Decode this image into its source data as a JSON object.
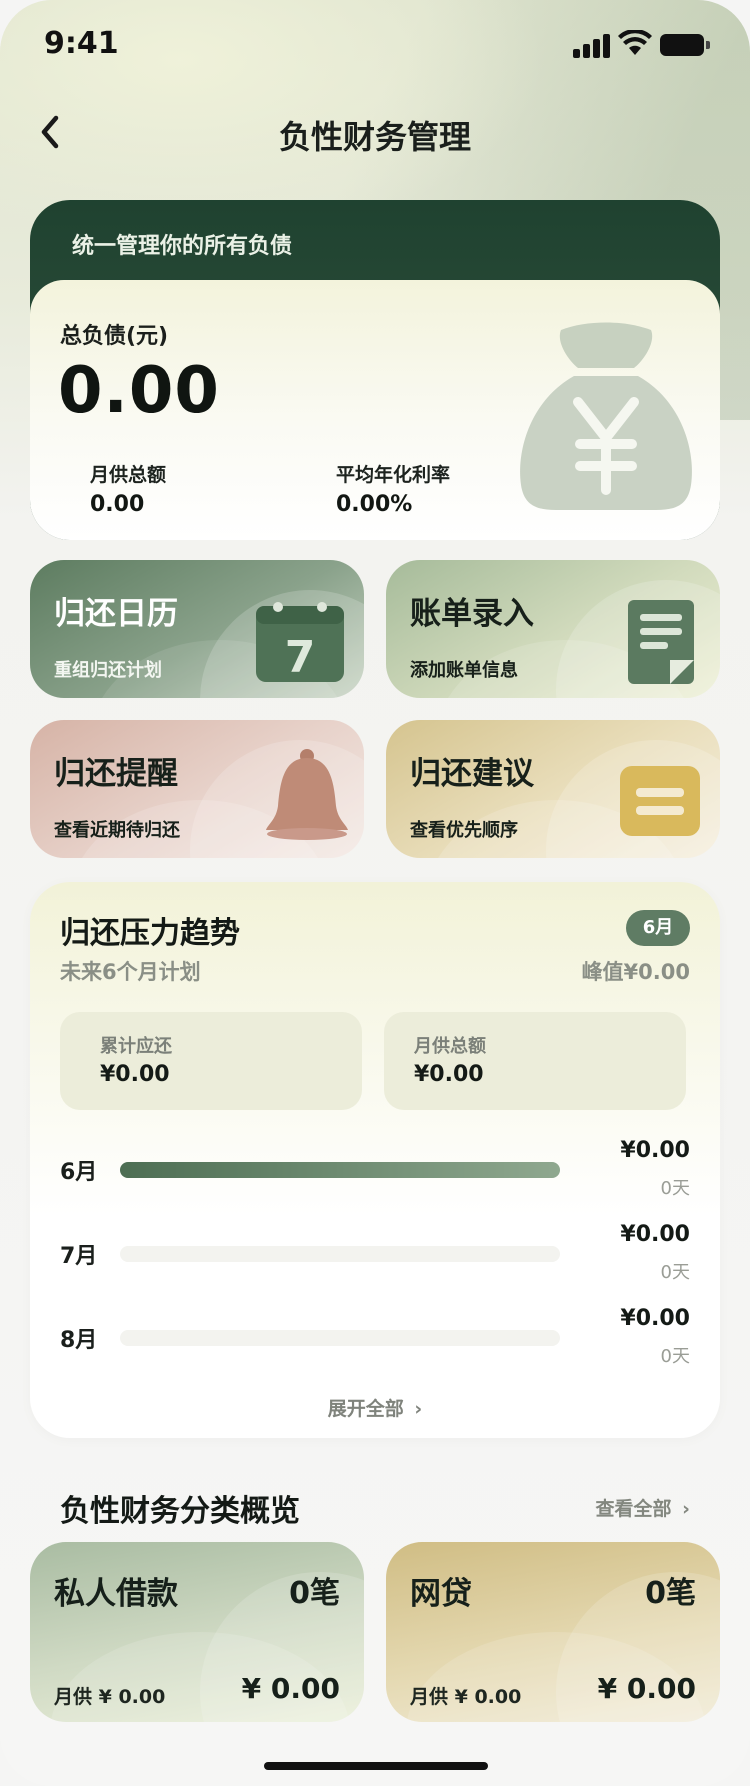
{
  "status_bar": {
    "time": "9:41"
  },
  "nav": {
    "title": "负性财务管理"
  },
  "debt_card": {
    "header": "统一管理你的所有负债",
    "total_label": "总负债(元)",
    "total_value": "0.00",
    "monthly_label": "月供总额",
    "monthly_value": "0.00",
    "rate_label": "平均年化利率",
    "rate_value": "0.00%"
  },
  "tiles": [
    {
      "title": "归还日历",
      "subtitle": "重组归还计划",
      "icon": "calendar-icon",
      "icon_text": "7"
    },
    {
      "title": "账单录入",
      "subtitle": "添加账单信息",
      "icon": "document-edit-icon"
    },
    {
      "title": "归还提醒",
      "subtitle": "查看近期待归还",
      "icon": "bell-icon"
    },
    {
      "title": "归还建议",
      "subtitle": "查看优先顺序",
      "icon": "message-icon"
    }
  ],
  "trend": {
    "title": "归还压力趋势",
    "subtitle": "未来6个月计划",
    "month_badge": "6月",
    "peak": "峰值¥0.00",
    "cumulative_label": "累计应还",
    "cumulative_value": "¥0.00",
    "monthly_label": "月供总额",
    "monthly_value": "¥0.00",
    "rows": [
      {
        "month": "6月",
        "amount": "¥0.00",
        "days": "0天",
        "fill": 1.0
      },
      {
        "month": "7月",
        "amount": "¥0.00",
        "days": "0天",
        "fill": 0.0
      },
      {
        "month": "8月",
        "amount": "¥0.00",
        "days": "0天",
        "fill": 0.0
      }
    ],
    "expand_label": "展开全部"
  },
  "categories": {
    "title": "负性财务分类概览",
    "see_all": "查看全部",
    "items": [
      {
        "name": "私人借款",
        "count": "0笔",
        "monthly": "月供 ¥ 0.00",
        "amount": "¥ 0.00"
      },
      {
        "name": "网贷",
        "count": "0笔",
        "monthly": "月供 ¥ 0.00",
        "amount": "¥ 0.00"
      }
    ]
  },
  "colors": {
    "brand_dark": "#1f4230",
    "accent_green": "#5f7c64",
    "tile_green": "#8fa88f",
    "tile_pink": "#d9b7a8",
    "tile_gold": "#d8c58e"
  }
}
